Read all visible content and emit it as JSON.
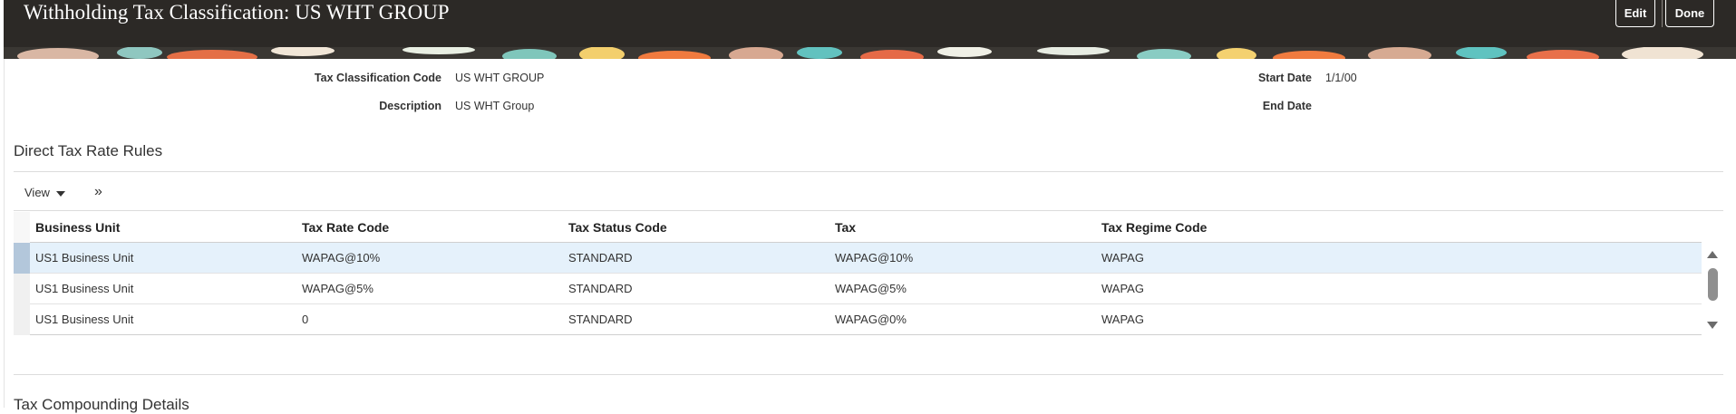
{
  "header": {
    "title": "Withholding Tax Classification: US WHT GROUP",
    "edit_label": "Edit",
    "done_label": "Done"
  },
  "fields": {
    "classification_code_label": "Tax Classification Code",
    "classification_code_value": "US WHT GROUP",
    "description_label": "Description",
    "description_value": "US WHT Group",
    "start_date_label": "Start Date",
    "start_date_value": "1/1/00",
    "end_date_label": "End Date",
    "end_date_value": ""
  },
  "direct_rules": {
    "title": "Direct Tax Rate Rules",
    "view_label": "View",
    "columns": [
      "Business Unit",
      "Tax Rate Code",
      "Tax Status Code",
      "Tax",
      "Tax Regime Code"
    ],
    "rows": [
      [
        "US1 Business Unit",
        "WAPAG@10%",
        "STANDARD",
        "WAPAG@10%",
        "WAPAG"
      ],
      [
        "US1 Business Unit",
        "WAPAG@5%",
        "STANDARD",
        "WAPAG@5%",
        "WAPAG"
      ],
      [
        "US1 Business Unit",
        "0",
        "STANDARD",
        "WAPAG@0%",
        "WAPAG"
      ]
    ]
  },
  "compounding": {
    "title": "Tax Compounding Details"
  },
  "colors": {
    "header_bg": "#2c2926",
    "selected_row_bg": "#e5f1fb"
  }
}
